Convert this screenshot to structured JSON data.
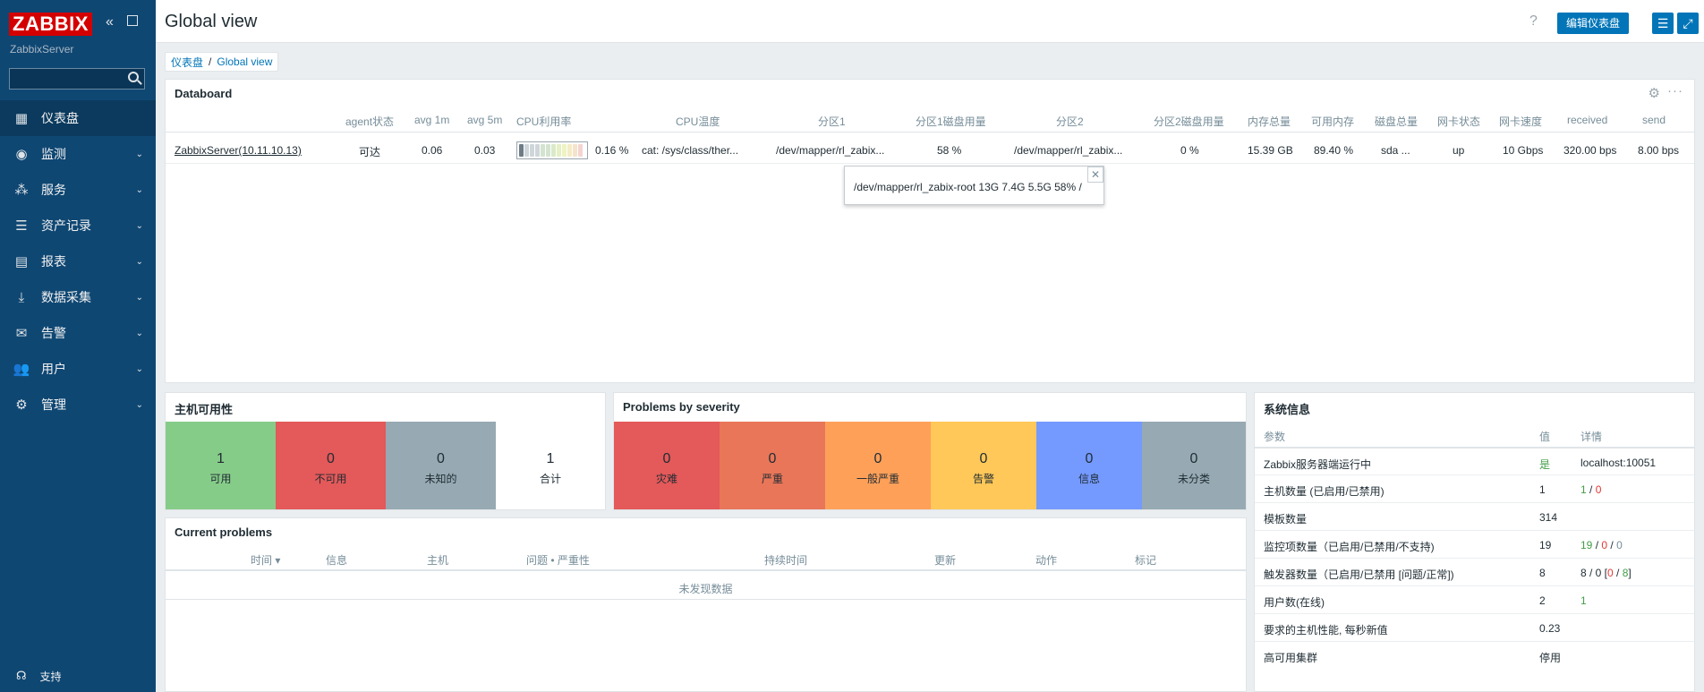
{
  "sidebar": {
    "logo": "ZABBIX",
    "server_name": "ZabbixServer",
    "search_placeholder": "",
    "items": [
      {
        "label": "仪表盘",
        "icon": "dashboard-icon"
      },
      {
        "label": "监测",
        "icon": "eye-icon"
      },
      {
        "label": "服务",
        "icon": "services-icon"
      },
      {
        "label": "资产记录",
        "icon": "list-icon"
      },
      {
        "label": "报表",
        "icon": "report-icon"
      },
      {
        "label": "数据采集",
        "icon": "download-icon"
      },
      {
        "label": "告警",
        "icon": "mail-icon"
      },
      {
        "label": "用户",
        "icon": "users-icon"
      },
      {
        "label": "管理",
        "icon": "gear-icon"
      }
    ],
    "support": "支持"
  },
  "header": {
    "title": "Global view",
    "help": "?",
    "edit_button": "编辑仪表盘"
  },
  "breadcrumb": {
    "root": "仪表盘",
    "sep": "/",
    "current": "Global view"
  },
  "databoard": {
    "title": "Databoard",
    "columns": [
      "agent状态",
      "avg 1m",
      "avg 5m",
      "CPU利用率",
      "CPU温度",
      "分区1",
      "分区1磁盘用量",
      "分区2",
      "分区2磁盘用量",
      "内存总量",
      "可用内存",
      "磁盘总量",
      "网卡状态",
      "网卡速度",
      "received",
      "send"
    ],
    "row": {
      "host": "ZabbixServer(10.11.10.13)",
      "agent": "可达",
      "avg1": "0.06",
      "avg5": "0.03",
      "cpu_util": "0.16 %",
      "cpu_util_fraction": 0.0016,
      "cpu_temp": "cat: /sys/class/ther...",
      "part1": "/dev/mapper/rl_zabix...",
      "part1_usage": "58 %",
      "part2": "/dev/mapper/rl_zabix...",
      "part2_usage": "0 %",
      "mem_total": "15.39 GB",
      "mem_avail": "89.40 %",
      "disk_total": "sda ...",
      "nic_status": "up",
      "nic_speed": "10 Gbps",
      "received": "320.00 bps",
      "send": "8.00 bps"
    },
    "tooltip": "/dev/mapper/rl_zabix-root   13G  7.4G  5.5G  58% /",
    "tooltip_close": "✕"
  },
  "host_availability": {
    "title": "主机可用性",
    "cells": [
      {
        "num": "1",
        "label": "可用",
        "color": "#86cc89"
      },
      {
        "num": "0",
        "label": "不可用",
        "color": "#e45959"
      },
      {
        "num": "0",
        "label": "未知的",
        "color": "#97aab3"
      },
      {
        "num": "1",
        "label": "合计",
        "color": "#ffffff"
      }
    ]
  },
  "severity": {
    "title": "Problems by severity",
    "cells": [
      {
        "num": "0",
        "label": "灾难",
        "color": "#e45959"
      },
      {
        "num": "0",
        "label": "严重",
        "color": "#e97659"
      },
      {
        "num": "0",
        "label": "一般严重",
        "color": "#ffa059"
      },
      {
        "num": "0",
        "label": "告警",
        "color": "#ffc859"
      },
      {
        "num": "0",
        "label": "信息",
        "color": "#7499ff"
      },
      {
        "num": "0",
        "label": "未分类",
        "color": "#97aab3"
      }
    ]
  },
  "current_problems": {
    "title": "Current problems",
    "columns": [
      "时间 ▾",
      "信息",
      "主机",
      "问题 • 严重性",
      "持续时间",
      "更新",
      "动作",
      "标记"
    ],
    "empty": "未发现数据"
  },
  "sysinfo": {
    "title": "系统信息",
    "columns": [
      "参数",
      "值",
      "详情"
    ],
    "rows": [
      {
        "param": "Zabbix服务器端运行中",
        "value": "是",
        "detail": "localhost:10051"
      },
      {
        "param": "主机数量 (已启用/已禁用)",
        "value": "1",
        "d1": "1",
        "dsep": " / ",
        "d2": "0"
      },
      {
        "param": "模板数量",
        "value": "314"
      },
      {
        "param": "监控项数量（已启用/已禁用/不支持)",
        "value": "19",
        "d1": "19",
        "dsep1": " / ",
        "d2": "0",
        "dsep2": " / ",
        "d3": "0"
      },
      {
        "param": "触发器数量（已启用/已禁用 [问题/正常])",
        "value": "8",
        "d_pre": "8 / 0 [",
        "d1": "0",
        "dsep": " / ",
        "d2": "8",
        "d_post": "]"
      },
      {
        "param": "用户数(在线)",
        "value": "2",
        "d1": "1"
      },
      {
        "param": "要求的主机性能, 每秒新值",
        "value": "0.23"
      },
      {
        "param": "高可用集群",
        "value": "停用"
      }
    ]
  }
}
